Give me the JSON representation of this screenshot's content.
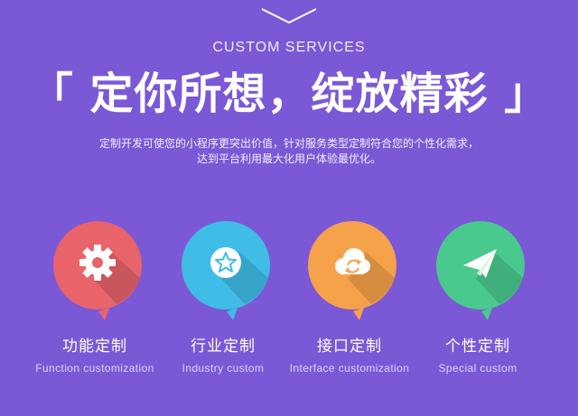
{
  "header": {
    "icon": "chevron-down-icon",
    "eyebrow": "CUSTOM SERVICES",
    "headline": "「 定你所想，绽放精彩 」",
    "description_line1": "定制开发可使您的小程序更突出价值，针对服务类型定制符合您的个性化需求，",
    "description_line2": "达到平台利用最大化用户体验最优化。"
  },
  "services": [
    {
      "title": "功能定制",
      "subtitle": "Function customization",
      "color": "#e9636b",
      "icon": "gear-icon"
    },
    {
      "title": "行业定制",
      "subtitle": "Industry custom",
      "color": "#3fbde6",
      "icon": "star-icon"
    },
    {
      "title": "接口定制",
      "subtitle": "Interface customization",
      "color": "#f6a24a",
      "icon": "cloud-sync-icon"
    },
    {
      "title": "个性定制",
      "subtitle": "Special custom",
      "color": "#49c98e",
      "icon": "paper-plane-icon"
    }
  ],
  "colors": {
    "background": "#7b58d6"
  }
}
